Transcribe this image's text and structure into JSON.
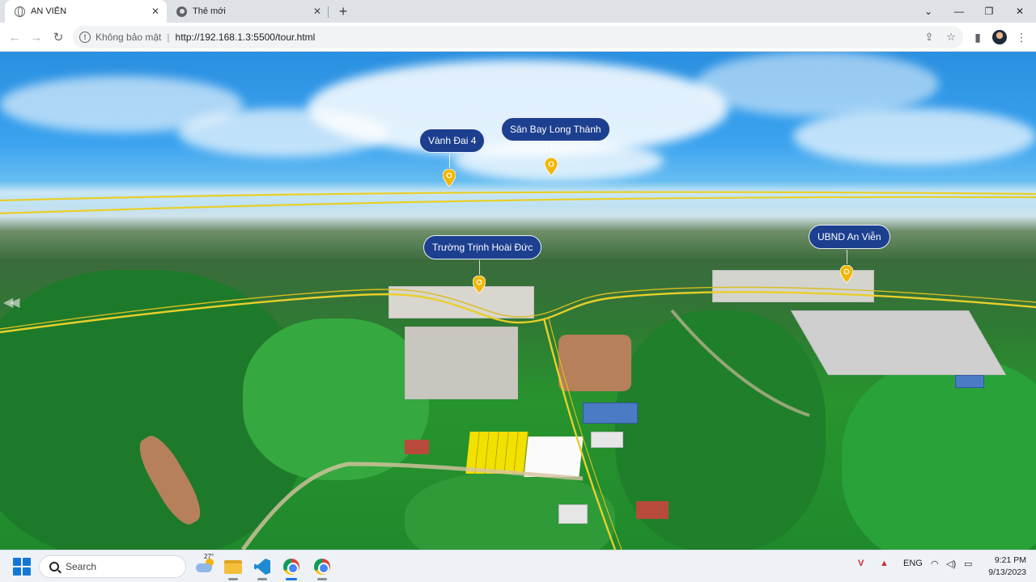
{
  "browser": {
    "tabs": [
      {
        "title": "AN VIỄN",
        "active": true
      },
      {
        "title": "Thẻ mới",
        "active": false
      }
    ],
    "security_text": "Không bảo mật",
    "url": "http://192.168.1.3:5500/tour.html"
  },
  "panorama": {
    "hotspots": [
      {
        "label": "Vành Đai 4",
        "icon": "location-pin-icon"
      },
      {
        "label": "Sân Bay Long Thành",
        "icon": "location-pin-icon"
      },
      {
        "label": "Trường Trịnh Hoài Đức",
        "icon": "location-pin-icon"
      },
      {
        "label": "UBND An Viễn",
        "icon": "location-pin-icon"
      }
    ],
    "colors": {
      "label_bg": "#1c3f8f",
      "pin": "#f2b705",
      "road": "#e8cf2a"
    }
  },
  "taskbar": {
    "search_placeholder": "Search",
    "weather_temp": "27°",
    "tray_lang": "ENG",
    "time": "9:21 PM",
    "date": "9/13/2023"
  }
}
